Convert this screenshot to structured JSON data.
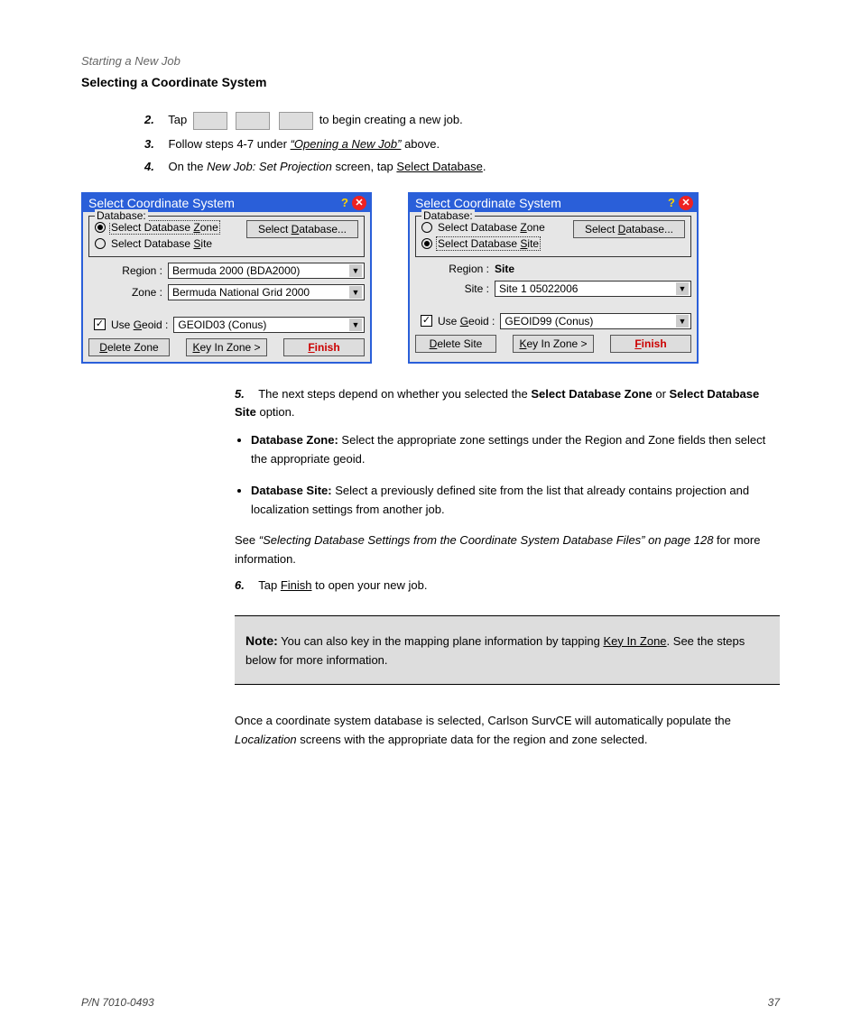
{
  "header": {
    "section": "Starting a New Job",
    "title": "Selecting a Coordinate System"
  },
  "instructions": [
    {
      "num": "2.",
      "prefix": "Tap ",
      "btns": [
        "",
        "",
        ""
      ],
      "suffix": " to begin creating a new job."
    },
    {
      "num": "3.",
      "prefix": "Follow steps 4-7 under ",
      "link": "“Opening a New Job”",
      "after": " above."
    },
    {
      "num": "4.",
      "prefix": "On the ",
      "em": "New Job: Set Projection",
      "mid": " screen, tap ",
      "link": "Select Database",
      "after": "."
    }
  ],
  "dialog_left": {
    "title": "Select Coordinate System",
    "fieldset_legend": "Database:",
    "radio_zone": "Select Database Zone",
    "radio_site": "Select Database Site",
    "btn_select_db": "Select Database...",
    "radio_zone_ul": "Z",
    "radio_site_ul": "S",
    "btn_select_db_ul": "D",
    "region_label": "Region :",
    "region_value": "Bermuda 2000 (BDA2000)",
    "zone_label": "Zone :",
    "zone_value": "Bermuda National Grid 2000",
    "geoid_label": "Use Geoid :",
    "geoid_ul": "G",
    "geoid_value": "GEOID03 (Conus)",
    "geoid_checked": true,
    "btn_delete": "Delete Zone",
    "btn_delete_ul": "D",
    "btn_keyin": "Key In Zone >",
    "btn_keyin_ul": "K",
    "btn_finish": "Finish",
    "btn_finish_ul": "F"
  },
  "dialog_right": {
    "title": "Select Coordinate System",
    "fieldset_legend": "Database:",
    "radio_zone": "Select Database Zone",
    "radio_site": "Select Database Site",
    "btn_select_db": "Select Database...",
    "radio_zone_ul": "Z",
    "radio_site_ul": "S",
    "btn_select_db_ul": "D",
    "region_label": "Region :",
    "region_value": "Site",
    "site_label": "Site :",
    "site_value": "Site 1 05022006",
    "geoid_label": "Use Geoid :",
    "geoid_ul": "G",
    "geoid_value": "GEOID99 (Conus)",
    "geoid_checked": true,
    "btn_delete": "Delete Site",
    "btn_delete_ul": "D",
    "btn_keyin": "Key In Zone >",
    "btn_keyin_ul": "K",
    "btn_finish": "Finish",
    "btn_finish_ul": "F"
  },
  "numbered_5": {
    "num": "5.",
    "text_before": "The next steps depend on whether you selected the ",
    "bold1": "Select Database Zone",
    "mid": " or ",
    "bold2": "Select Database Site",
    "after": " option."
  },
  "bullets": [
    {
      "strong": "Database Zone:",
      "text": " Select the appropriate zone settings under the Region and Zone fields then select the appropriate geoid."
    },
    {
      "strong": "Database Site:",
      "text": " Select a previously defined site from the list that already contains projection and localization settings from another job."
    }
  ],
  "para_after": {
    "before_link": "See ",
    "link": "“Selecting Database Settings from the Coordinate System Database Files” on page 128",
    "after_link": " for more information."
  },
  "numbered_6": {
    "num": "6.",
    "before_link": "Tap ",
    "link": "Finish",
    "after_link": " to open your new job."
  },
  "note": {
    "label": "Note:",
    "text": " You can also key in the mapping plane information by tapping ",
    "link": "Key In Zone",
    "after": ". See the steps below for more information."
  },
  "closing": {
    "before": "Once a coordinate system database is selected, Carlson SurvCE will automatically populate the ",
    "em": "Localization",
    "after": " screens with the appropriate data for the region and zone selected."
  },
  "footer": {
    "left": "P/N 7010-0493",
    "right": "37"
  }
}
